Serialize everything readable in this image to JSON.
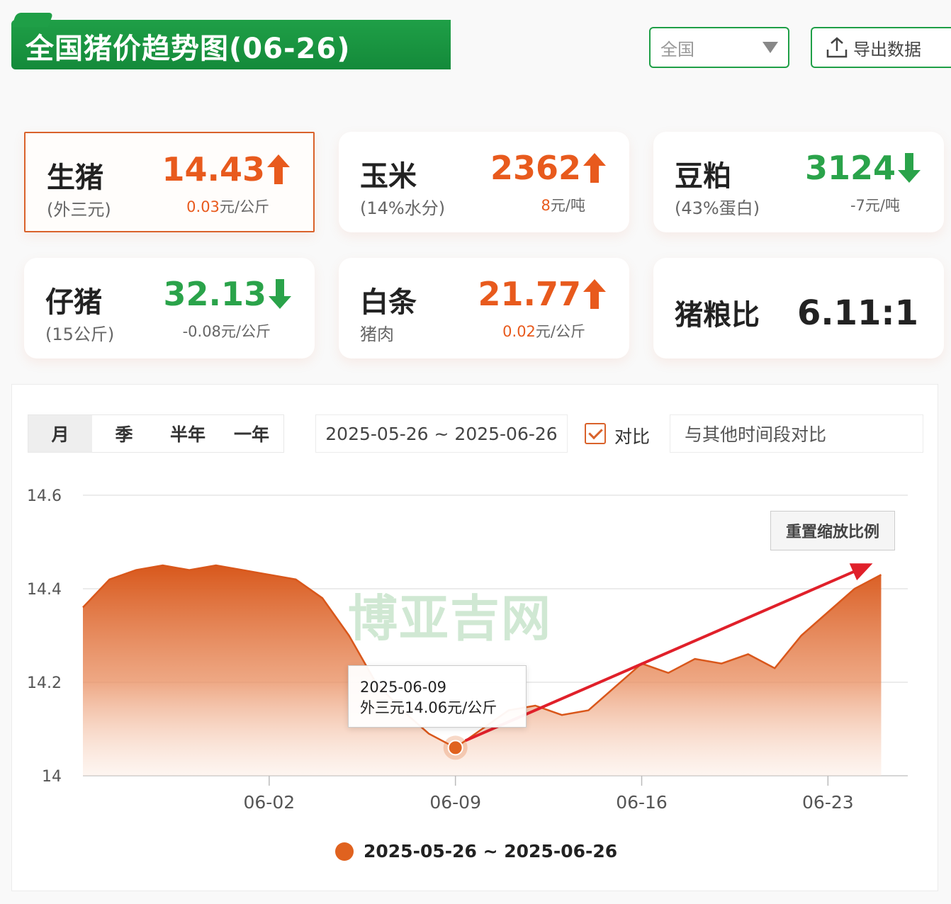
{
  "header": {
    "title": "全国猪价趋势图(06-26)",
    "region_select": {
      "value": "全国"
    },
    "export_label": "导出数据"
  },
  "cards": [
    {
      "name": "生猪",
      "sub": "(外三元)",
      "value": "14.43",
      "direction": "up",
      "change_num": "0.03",
      "change_unit": "元/公斤"
    },
    {
      "name": "玉米",
      "sub": "(14%水分)",
      "value": "2362",
      "direction": "up",
      "change_num": "8",
      "change_unit": "元/吨"
    },
    {
      "name": "豆粕",
      "sub": "(43%蛋白)",
      "value": "3124",
      "direction": "down",
      "change_num": "-7",
      "change_unit": "元/吨"
    },
    {
      "name": "仔猪",
      "sub": "(15公斤)",
      "value": "32.13",
      "direction": "down",
      "change_num": "-0.08",
      "change_unit": "元/公斤"
    },
    {
      "name": "白条",
      "sub": "猪肉",
      "value": "21.77",
      "direction": "up",
      "change_num": "0.02",
      "change_unit": "元/公斤"
    },
    {
      "name": "猪粮比",
      "value": "6.11:1"
    }
  ],
  "controls": {
    "period_tabs": [
      "月",
      "季",
      "半年",
      "一年"
    ],
    "active_tab": 0,
    "date_range": "2025-05-26 ~ 2025-06-26",
    "compare_label": "对比",
    "compare_checked": true,
    "compare_placeholder": "与其他时间段对比",
    "reset_zoom_label": "重置缩放比例"
  },
  "watermark": "博亚吉网",
  "tooltip": {
    "date": "2025-06-09",
    "text": "外三元14.06元/公斤"
  },
  "colors": {
    "brand_green": "#1f9f47",
    "accent_orange": "#e0621f",
    "up_red": "#e85a1d",
    "down_green": "#2aa34a",
    "arrow_red": "#e0202a"
  },
  "chart_data": {
    "type": "area",
    "x": [
      "2025-05-26",
      "2025-05-27",
      "2025-05-28",
      "2025-05-29",
      "2025-05-30",
      "2025-05-31",
      "2025-06-01",
      "2025-06-02",
      "2025-06-03",
      "2025-06-04",
      "2025-06-05",
      "2025-06-06",
      "2025-06-07",
      "2025-06-08",
      "2025-06-09",
      "2025-06-10",
      "2025-06-11",
      "2025-06-12",
      "2025-06-13",
      "2025-06-14",
      "2025-06-15",
      "2025-06-16",
      "2025-06-17",
      "2025-06-18",
      "2025-06-19",
      "2025-06-20",
      "2025-06-21",
      "2025-06-22",
      "2025-06-23",
      "2025-06-24",
      "2025-06-25",
      "2025-06-26"
    ],
    "series": [
      {
        "name": "2025-05-26 ~ 2025-06-26",
        "values": [
          14.36,
          14.42,
          14.44,
          14.45,
          14.44,
          14.45,
          14.44,
          14.43,
          14.42,
          14.38,
          14.3,
          14.2,
          14.14,
          14.09,
          14.06,
          14.1,
          14.14,
          14.15,
          14.13,
          14.14,
          14.19,
          14.24,
          14.22,
          14.25,
          14.24,
          14.26,
          14.23,
          14.3,
          14.35,
          14.4,
          14.43
        ]
      }
    ],
    "xticks": [
      "06-02",
      "06-09",
      "06-16",
      "06-23"
    ],
    "ylim": [
      14,
      14.6
    ],
    "yticks": [
      14,
      14.2,
      14.4,
      14.6
    ],
    "grid": true,
    "highlight_point": {
      "x": "2025-06-09",
      "y": 14.06
    },
    "legend_position": "bottom-center"
  }
}
